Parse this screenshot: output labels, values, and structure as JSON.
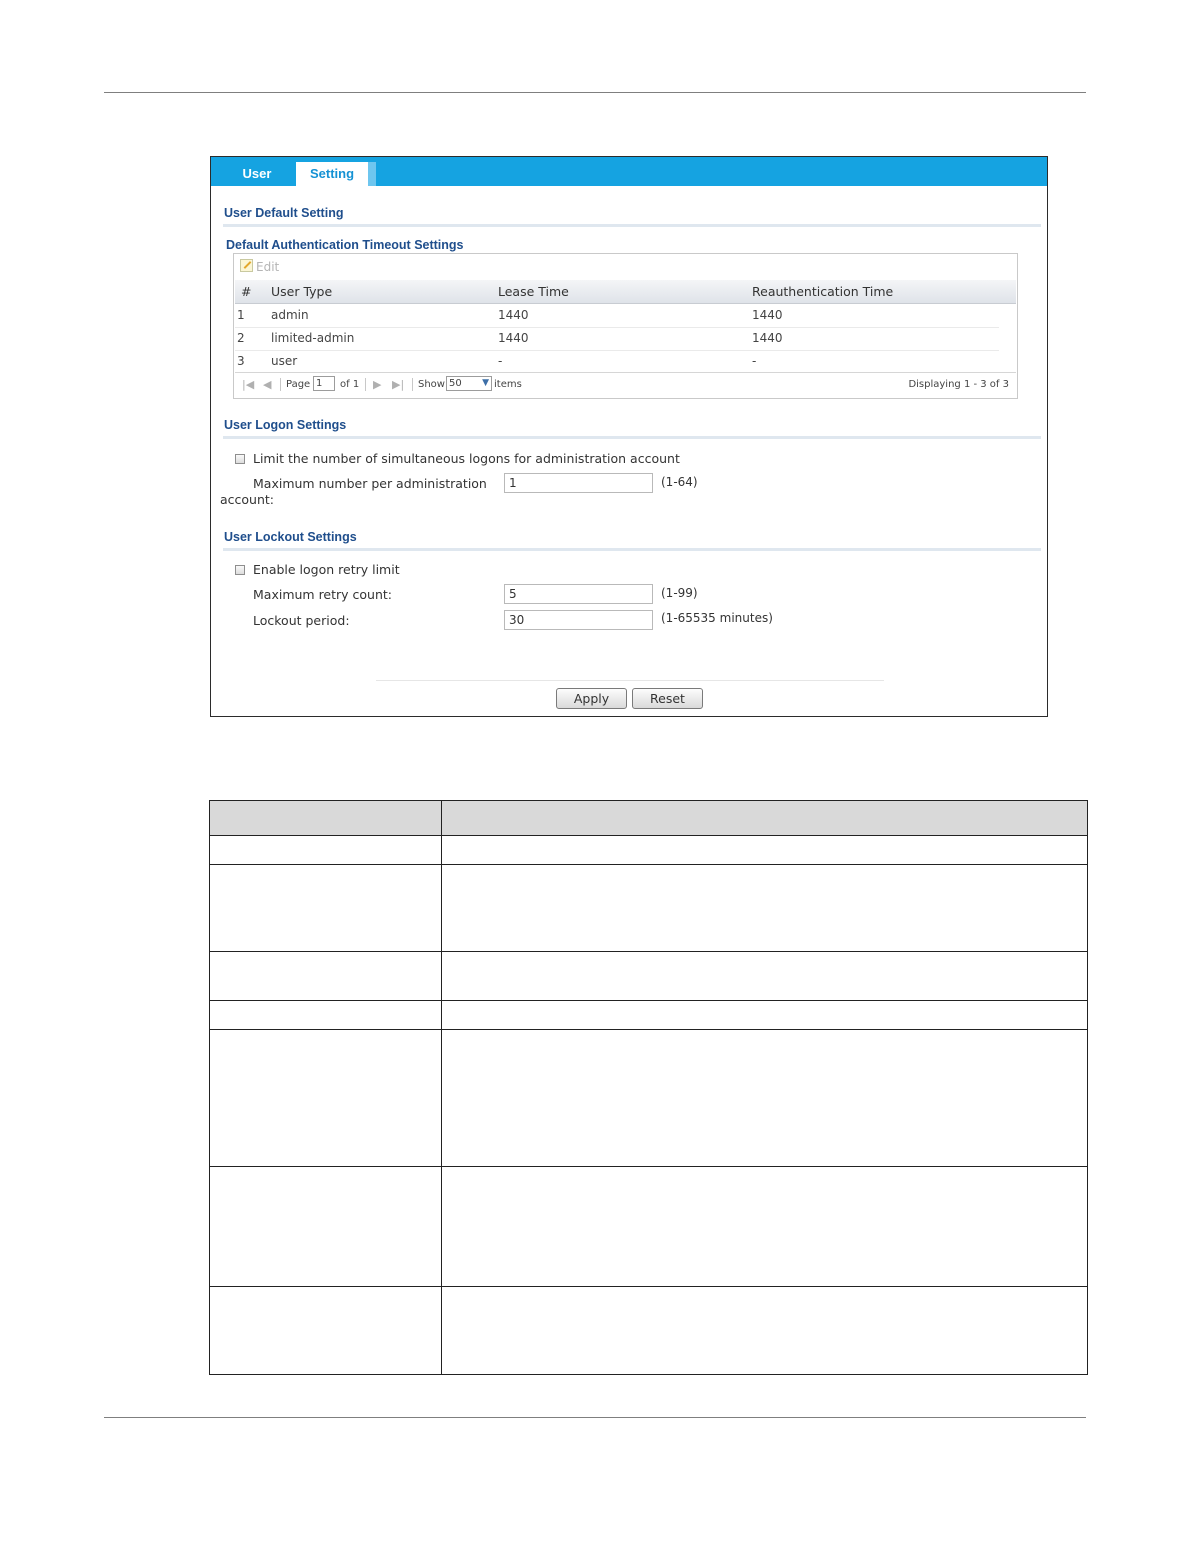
{
  "tabs": [
    {
      "label": "User"
    },
    {
      "label": "Setting"
    }
  ],
  "sections": {
    "user_default": "User Default Setting",
    "auth_timeout": "Default Authentication Timeout Settings",
    "logon": "User Logon Settings",
    "lockout": "User Lockout Settings"
  },
  "auth_table": {
    "edit_label": "Edit",
    "columns": [
      "#",
      "User Type",
      "Lease Time",
      "Reauthentication Time"
    ],
    "rows": [
      {
        "num": "1",
        "type": "admin",
        "lease": "1440",
        "reauth": "1440"
      },
      {
        "num": "2",
        "type": "limited-admin",
        "lease": "1440",
        "reauth": "1440"
      },
      {
        "num": "3",
        "type": "user",
        "lease": "-",
        "reauth": "-"
      }
    ],
    "pager": {
      "page_label": "Page",
      "page_value": "1",
      "of_label": "of 1",
      "show_label": "Show",
      "show_value": "50",
      "items_label": "items",
      "displaying": "Displaying 1 - 3 of 3"
    }
  },
  "logon": {
    "limit_label": "Limit the number of simultaneous logons for administration account",
    "limit_checked": false,
    "max_label_1": "Maximum number per administration",
    "max_label_2": "account:",
    "max_value": "1",
    "max_range": "(1-64)"
  },
  "lockout": {
    "enable_label": "Enable logon retry limit",
    "enable_checked": false,
    "retry_label": "Maximum retry count:",
    "retry_value": "5",
    "retry_range": "(1-99)",
    "period_label": "Lockout period:",
    "period_value": "30",
    "period_range": "(1-65535 minutes)"
  },
  "buttons": {
    "apply": "Apply",
    "reset": "Reset"
  },
  "colors": {
    "tab_bar": "#15a3e1",
    "section_title": "#1f4e8c"
  }
}
